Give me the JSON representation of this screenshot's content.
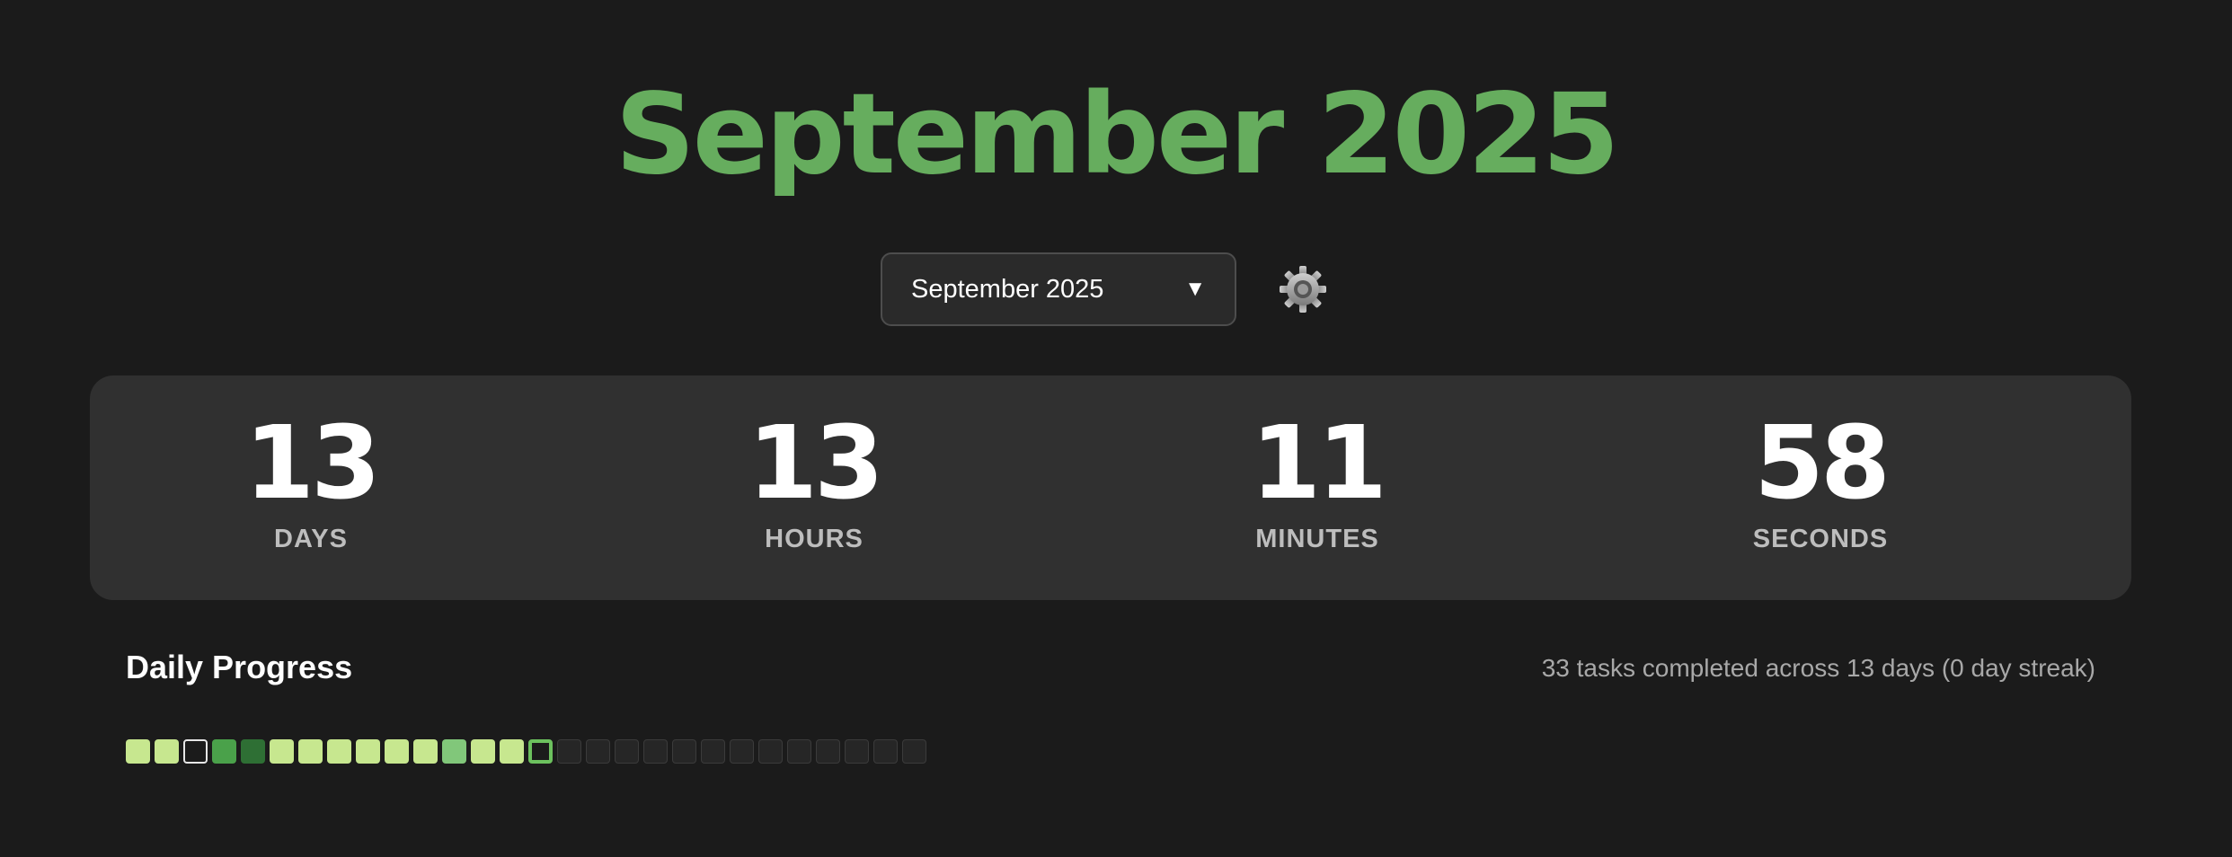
{
  "title": "September 2025",
  "month_select": {
    "value": "September 2025",
    "arrow": "▼"
  },
  "settings_icon": "gear-icon",
  "countdown": [
    {
      "value": "13",
      "label": "DAYS"
    },
    {
      "value": "13",
      "label": "HOURS"
    },
    {
      "value": "11",
      "label": "MINUTES"
    },
    {
      "value": "58",
      "label": "SECONDS"
    }
  ],
  "progress": {
    "title": "Daily Progress",
    "summary": "33 tasks completed across 13 days (0 day streak)",
    "days": [
      "lvl-1",
      "lvl-1",
      "empty",
      "lvl-3",
      "lvl-4",
      "lvl-1",
      "lvl-1",
      "lvl-1",
      "lvl-1",
      "lvl-1",
      "lvl-1",
      "lvl-2",
      "lvl-1",
      "lvl-1",
      "today",
      "future",
      "future",
      "future",
      "future",
      "future",
      "future",
      "future",
      "future",
      "future",
      "future",
      "future",
      "future",
      "future"
    ]
  },
  "colors": {
    "accent": "#66ad5e",
    "background": "#1b1b1b",
    "panel": "#303030"
  }
}
